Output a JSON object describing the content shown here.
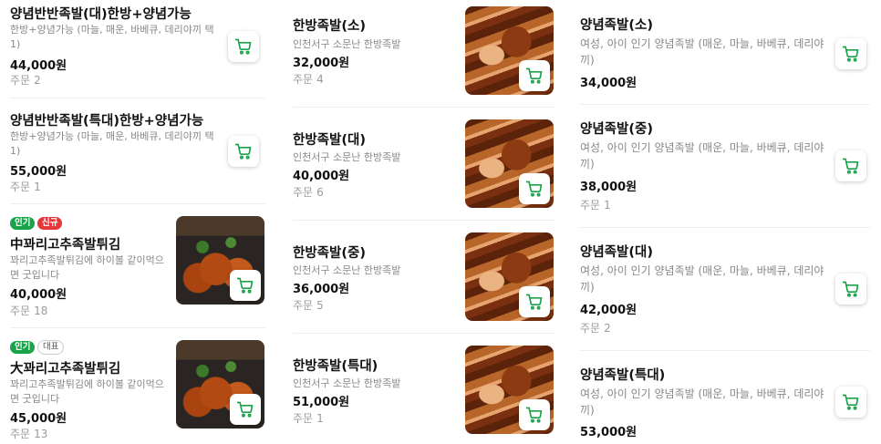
{
  "currency": "원",
  "orders_label": "주문",
  "columns": [
    {
      "items": [
        {
          "name": "양념반반족발(대)한방+양념가능",
          "desc": "한방+양념가능 (마늘, 매운, 바베큐, 데리야끼 택1)",
          "price": "44,000",
          "orders": "2"
        },
        {
          "name": "양념반반족발(특대)한방+양념가능",
          "desc": "한방+양념가능 (마늘, 매운, 바베큐, 데리야끼 택1)",
          "price": "55,000",
          "orders": "1"
        },
        {
          "badges": [
            "인기",
            "신규"
          ],
          "name": "中꽈리고추족발튀김",
          "desc": "꽈리고추족발튀김에 하이볼 같이먹으면 굿입니다",
          "price": "40,000",
          "orders": "18"
        },
        {
          "badges": [
            "인기",
            "대표"
          ],
          "name": "大꽈리고추족발튀김",
          "desc": "꽈리고추족발튀김에 하이볼 같이먹으면 굿입니다",
          "price": "45,000",
          "orders": "13"
        }
      ]
    },
    {
      "items": [
        {
          "name": "한방족발(소)",
          "desc": "인천서구 소문난 한방족발",
          "price": "32,000",
          "orders": "4"
        },
        {
          "name": "한방족발(대)",
          "desc": "인천서구 소문난 한방족발",
          "price": "40,000",
          "orders": "6"
        },
        {
          "name": "한방족발(중)",
          "desc": "인천서구 소문난 한방족발",
          "price": "36,000",
          "orders": "5"
        },
        {
          "name": "한방족발(특대)",
          "desc": "인천서구 소문난 한방족발",
          "price": "51,000",
          "orders": "1"
        }
      ]
    },
    {
      "items": [
        {
          "name": "양념족발(소)",
          "desc": "여성, 아이 인기 양념족발 (매운, 마늘, 바베큐, 데리야끼)",
          "price": "34,000"
        },
        {
          "name": "양념족발(중)",
          "desc": "여성, 아이 인기 양념족발 (매운, 마늘, 바베큐, 데리야끼)",
          "price": "38,000",
          "orders": "1"
        },
        {
          "name": "양념족발(대)",
          "desc": "여성, 아이 인기 양념족발 (매운, 마늘, 바베큐, 데리야끼)",
          "price": "42,000",
          "orders": "2"
        },
        {
          "name": "양념족발(특대)",
          "desc": "여성, 아이 인기 양념족발 (매운, 마늘, 바베큐, 데리야끼)",
          "price": "53,000"
        }
      ]
    }
  ],
  "colors": {
    "accent": "#1aa34a",
    "badge_popular": "#1aa34a",
    "badge_new": "#e5383b"
  },
  "icons": {
    "cart": "shopping-cart-icon"
  }
}
